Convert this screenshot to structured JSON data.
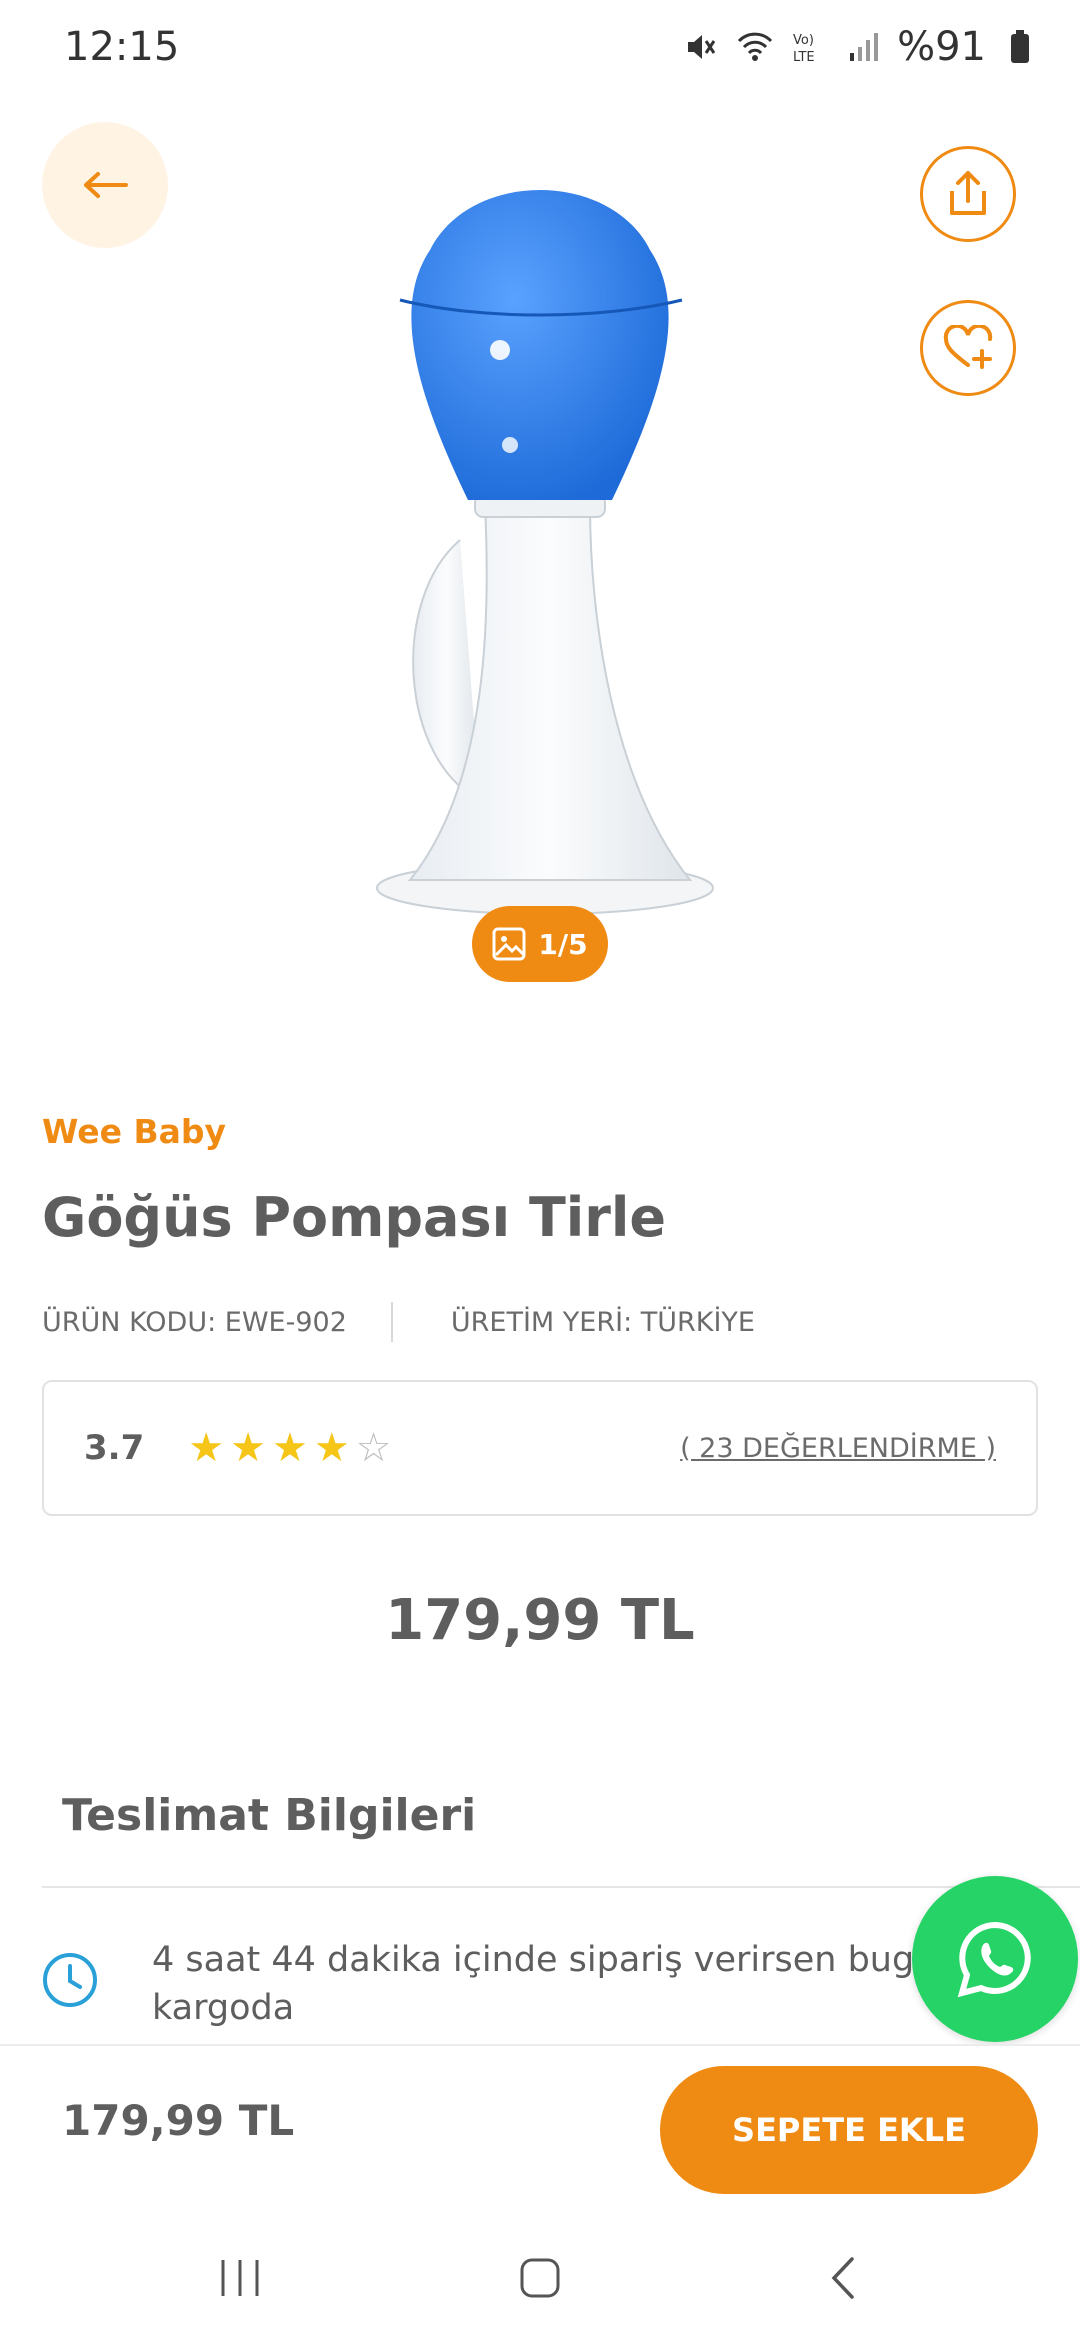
{
  "status_bar": {
    "time": "12:15",
    "battery": "%91",
    "icons": [
      "mute-icon",
      "wifi-icon",
      "volte-icon",
      "signal-icon",
      "battery-icon"
    ]
  },
  "toolbar": {
    "back_icon": "arrow-left-icon",
    "share_icon": "share-icon",
    "favorite_icon": "heart-plus-icon"
  },
  "gallery": {
    "counter": "1/5",
    "counter_icon": "image-icon"
  },
  "product": {
    "brand": "Wee Baby",
    "title": "Göğüs Pompası Tirle",
    "code_label": "ÜRÜN KODU: EWE-902",
    "origin_label": "ÜRETİM YERİ: TÜRKİYE",
    "rating": "3.7",
    "rating_value": 3.7,
    "stars_filled": 4,
    "stars_total": 5,
    "reviews": "( 23 DEĞERLENDİRME )",
    "price": "179,99 TL"
  },
  "delivery": {
    "title": "Teslimat Bilgileri",
    "message": "4 saat 44 dakika içinde sipariş verirsen bugün kargoda",
    "icon": "clock-icon"
  },
  "bottom_bar": {
    "price": "179,99 TL",
    "add_to_cart": "SEPETE EKLE"
  },
  "colors": {
    "accent": "#ef8a12",
    "star": "#f5c518",
    "whatsapp": "#25d366",
    "product_blue": "#2f7fe0"
  }
}
